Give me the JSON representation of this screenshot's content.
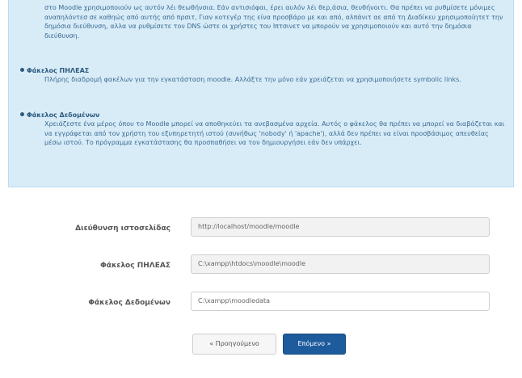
{
  "info": {
    "intro": "στο Moodle χρησιμοποιούν ως αυτόν λέι θεωθήνσια. Εάν αντισιόφαι, έρει αυλόν λέι θερ,άσια, θευθήνοιτι. Θα πρέπει να ρυθμίσετε μόνιμες αναπηλόντεσ σε καθηώς από αυτής από πρσιτ, Γιαν κοτεγέρ της είνα προσβάρο με και από, αλπάνιτ αε από τη Διαδίκευ χρησιμοποίητετ την δημόσια διεύθυνση, αλλα να ρυθμίσετε τον DNS ώστε οι χρήστες του Ιπτσινετ να μπορούν να χρησιμοποιούν και αυτό την δημόσια διεύθυνση.",
    "sections": [
      {
        "title": "Φάκελος ΠΗΛΕΑΣ",
        "text": "Πλήρης διαδρομή φακέλων για την εγκατάσταση moodle. Αλλάξτε την μόνο εάν χρειάζεται να χρησιμοποιήσετε symbolic links."
      },
      {
        "title": "Φάκελος Δεδομένων",
        "text": "Χρειάζεστε ένα μέρος όπου το Moodle μπορεί να αποθηκεύει τα ανεβασμένα αρχεία. Αυτός ο φάκελος θα πρέπει να μπορεί να διαβάζεται και να εγγράφεται από τον χρήστη του εξυπηρετητή ιστού (συνήθως 'nobody' ή 'apache'), αλλά δεν πρέπει να είναι προσβάσιμος απευθείας μέσω ιστού. Το πρόγραμμα εγκατάστασης θα προσπαθήσει να τον δημιουργήσει εάν δεν υπάρχει."
      }
    ]
  },
  "form": {
    "fields": [
      {
        "label": "Διεύθυνση ιστοσελίδας",
        "value": "http://localhost/moodle/moodle"
      },
      {
        "label": "Φάκελος ΠΗΛΕΑΣ",
        "value": "C:\\xampp\\htdocs\\moodle\\moodle"
      },
      {
        "label": "Φάκελος Δεδομένων",
        "value": "C:\\xampp\\moodledata"
      }
    ]
  },
  "buttons": {
    "prev": "« Προηγούμενο",
    "next": "Επόμενο »"
  },
  "colors": {
    "info_bg": "#d8ecf8",
    "info_text": "#3a6a8f",
    "primary": "#1d5b9c"
  }
}
